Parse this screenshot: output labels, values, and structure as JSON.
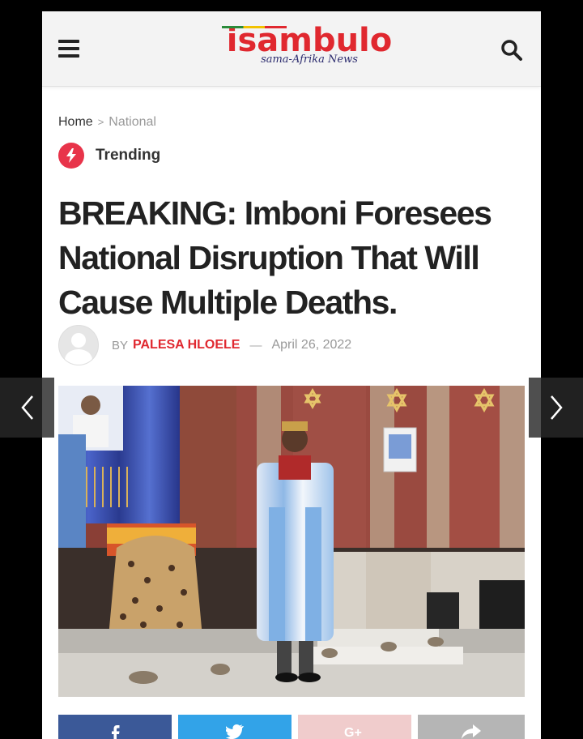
{
  "header": {
    "logo_main": "isambulo",
    "logo_sub": "sama-Afrika News",
    "menu_icon": "hamburger-menu-icon",
    "search_icon": "search-icon"
  },
  "breadcrumb": {
    "home": "Home",
    "separator": ">",
    "current": "National"
  },
  "category": {
    "icon": "lightning-bolt-icon",
    "label": "Trending"
  },
  "article": {
    "headline": "BREAKING: Imboni Foresees National Disruption That Will Cause Multiple Deaths.",
    "by_label": "BY",
    "author": "PALESA HLOELE",
    "dash": "—",
    "date": "April 26, 2022"
  },
  "share_buttons": [
    {
      "name": "facebook",
      "icon": "facebook-icon"
    },
    {
      "name": "twitter",
      "icon": "twitter-icon"
    },
    {
      "name": "google-plus",
      "icon": "google-plus-icon"
    },
    {
      "name": "share",
      "icon": "share-arrow-icon"
    }
  ],
  "viewer": {
    "prev_icon": "chevron-left-icon",
    "next_icon": "chevron-right-icon"
  },
  "colors": {
    "brand_red": "#e0282f",
    "trending_red": "#e8344a",
    "facebook": "#3b5998",
    "twitter": "#32a3e8"
  }
}
